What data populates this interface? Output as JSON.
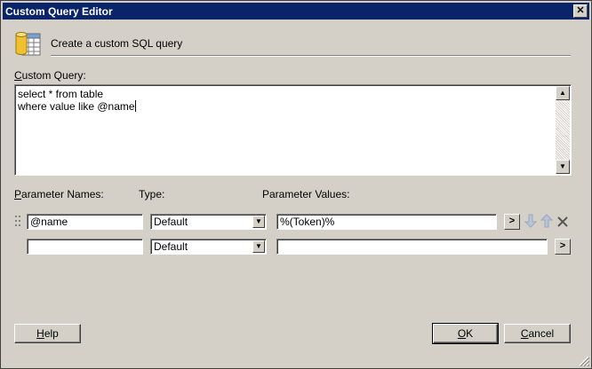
{
  "window": {
    "title": "Custom Query Editor",
    "close_glyph": "✕"
  },
  "header": {
    "text": "Create a custom SQL query",
    "icon": "database-table-icon"
  },
  "query": {
    "label_accel": "C",
    "label_rest": "ustom Query:",
    "lines": [
      "select * from table",
      "where value like @name"
    ]
  },
  "params": {
    "names_label_accel": "P",
    "names_label_rest": "arameter Names:",
    "type_label": "Type:",
    "values_label": "Parameter Values:",
    "rows": [
      {
        "name": "@name",
        "type": "Default",
        "value": "%(Token)%",
        "button": ">"
      },
      {
        "name": "",
        "type": "Default",
        "value": "",
        "button": ">"
      }
    ]
  },
  "buttons": {
    "help_accel": "H",
    "help_rest": "elp",
    "ok_accel": "O",
    "ok_rest": "K",
    "cancel_accel": "C",
    "cancel_rest": "ancel"
  }
}
